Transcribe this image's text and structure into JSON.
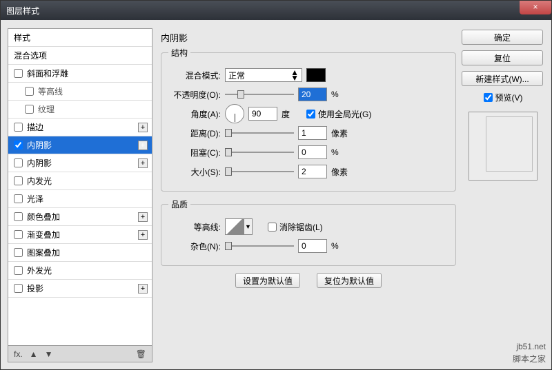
{
  "window": {
    "title": "图层样式",
    "close_glyph": "×"
  },
  "styles": {
    "header1": "样式",
    "header2": "混合选项",
    "items": [
      {
        "label": "斜面和浮雕",
        "checked": false,
        "plus": false
      },
      {
        "label": "等高线",
        "checked": false,
        "plus": false,
        "sub": true
      },
      {
        "label": "纹理",
        "checked": false,
        "plus": false,
        "sub": true
      },
      {
        "label": "描边",
        "checked": false,
        "plus": true
      },
      {
        "label": "内阴影",
        "checked": true,
        "plus": true,
        "selected": true
      },
      {
        "label": "内阴影",
        "checked": false,
        "plus": true
      },
      {
        "label": "内发光",
        "checked": false,
        "plus": false
      },
      {
        "label": "光泽",
        "checked": false,
        "plus": false
      },
      {
        "label": "颜色叠加",
        "checked": false,
        "plus": true
      },
      {
        "label": "渐变叠加",
        "checked": false,
        "plus": true
      },
      {
        "label": "图案叠加",
        "checked": false,
        "plus": false
      },
      {
        "label": "外发光",
        "checked": false,
        "plus": false
      },
      {
        "label": "投影",
        "checked": false,
        "plus": true
      }
    ],
    "footer": {
      "fx": "fx.",
      "up": "▲",
      "down": "▼",
      "trash": "🗑"
    }
  },
  "panel": {
    "title": "内阴影",
    "structure": {
      "legend": "结构",
      "blend_mode_label": "混合模式:",
      "blend_mode_value": "正常",
      "opacity_label": "不透明度(O):",
      "opacity_value": "20",
      "opacity_unit": "%",
      "angle_label": "角度(A):",
      "angle_value": "90",
      "angle_unit": "度",
      "global_light_label": "使用全局光(G)",
      "global_light_checked": true,
      "distance_label": "距离(D):",
      "distance_value": "1",
      "distance_unit": "像素",
      "choke_label": "阻塞(C):",
      "choke_value": "0",
      "choke_unit": "%",
      "size_label": "大小(S):",
      "size_value": "2",
      "size_unit": "像素"
    },
    "quality": {
      "legend": "品质",
      "contour_label": "等高线:",
      "antialias_label": "消除锯齿(L)",
      "noise_label": "杂色(N):",
      "noise_value": "0",
      "noise_unit": "%"
    },
    "buttons": {
      "set_default": "设置为默认值",
      "reset_default": "复位为默认值"
    }
  },
  "right": {
    "ok": "确定",
    "cancel": "复位",
    "new_style": "新建样式(W)...",
    "preview_label": "预览(V)",
    "preview_checked": true
  },
  "watermark": {
    "line1": "jb51.net",
    "line2": "脚本之家"
  }
}
